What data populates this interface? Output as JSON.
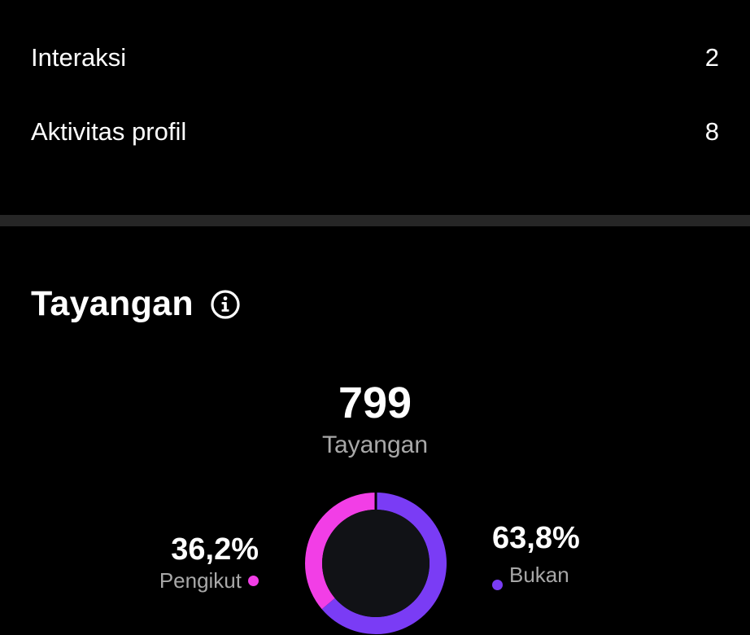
{
  "metrics": [
    {
      "label": "Interaksi",
      "value": "2"
    },
    {
      "label": "Aktivitas profil",
      "value": "8"
    }
  ],
  "views_section": {
    "title": "Tayangan",
    "info_icon": "info-circle-icon",
    "total": "799",
    "total_label": "Tayangan"
  },
  "chart_data": {
    "type": "pie",
    "title": "",
    "slices": [
      {
        "label": "Pengikut",
        "display": "36,2%",
        "value": 36.2,
        "color": "#f23ee6"
      },
      {
        "label": "Bukan",
        "display": "63,8%",
        "value": 63.8,
        "color": "#7a3cf5"
      }
    ],
    "center_color": "#111216",
    "legend": "left-and-right"
  }
}
